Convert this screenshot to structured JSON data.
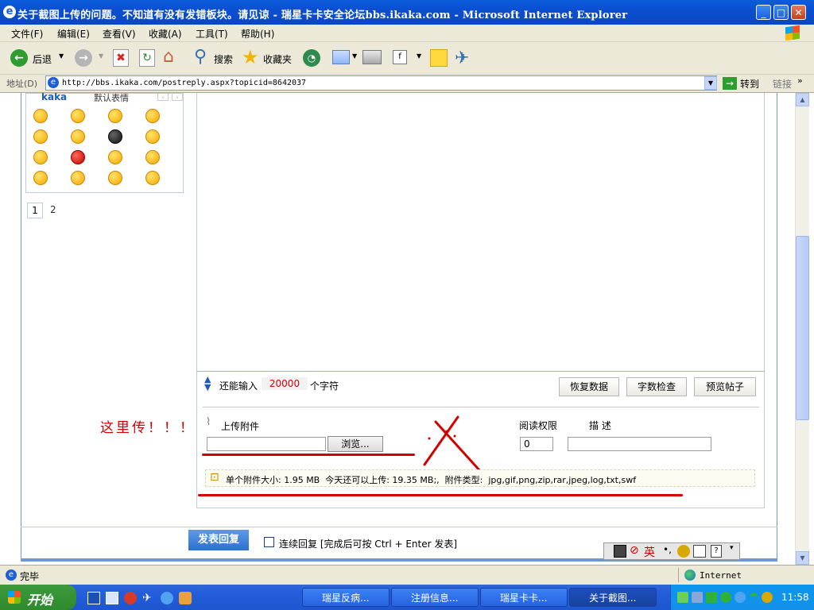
{
  "window": {
    "title": "关于截图上传的问题。不知道有没有发错板块。请见谅 - 瑞星卡卡安全论坛bbs.ikaka.com - Microsoft Internet Explorer"
  },
  "menu": [
    "文件(F)",
    "编辑(E)",
    "查看(V)",
    "收藏(A)",
    "工具(T)",
    "帮助(H)"
  ],
  "toolbar": {
    "back": "后退",
    "search": "搜索",
    "favorites": "收藏夹"
  },
  "address": {
    "label": "地址(D)",
    "url": "http://bbs.ikaka.com/postreply.aspx?topicid=8642037",
    "go": "转到",
    "links": "链接"
  },
  "emoticons": {
    "tab_active": "kaka",
    "tab_other": "默认表情",
    "pages": [
      "1",
      "2"
    ]
  },
  "editor": {
    "remain_label": "还能输入",
    "remain_count": "20000",
    "remain_unit": "个字符",
    "btn_restore": "恢复数据",
    "btn_check": "字数检查",
    "btn_preview": "预览帖子"
  },
  "attachment": {
    "label": "上传附件",
    "browse": "浏览...",
    "perm_label": "阅读权限",
    "desc_label": "描 述",
    "perm_value": "0",
    "info": "单个附件大小: 1.95 MB  今天还可以上传: 19.35 MB;,  附件类型:  jpg,gif,png,zip,rar,jpeg,log,txt,swf"
  },
  "annotation": {
    "text": "这里传！！！"
  },
  "submit": {
    "btn": "发表回复",
    "continuous": "连续回复 [完成后可按 Ctrl + Enter 发表]"
  },
  "ime": {
    "lang": "英"
  },
  "status": {
    "text": "完毕",
    "zone": "Internet"
  },
  "taskbar": {
    "start": "开始",
    "tasks": [
      "瑞星反病...",
      "注册信息...",
      "瑞星卡卡...",
      "关于截图..."
    ],
    "clock": "11:58"
  },
  "colors": {
    "accent_red": "#d40000",
    "xp_blue": "#0a5ddc",
    "submit_blue": "#3b7dd8"
  }
}
